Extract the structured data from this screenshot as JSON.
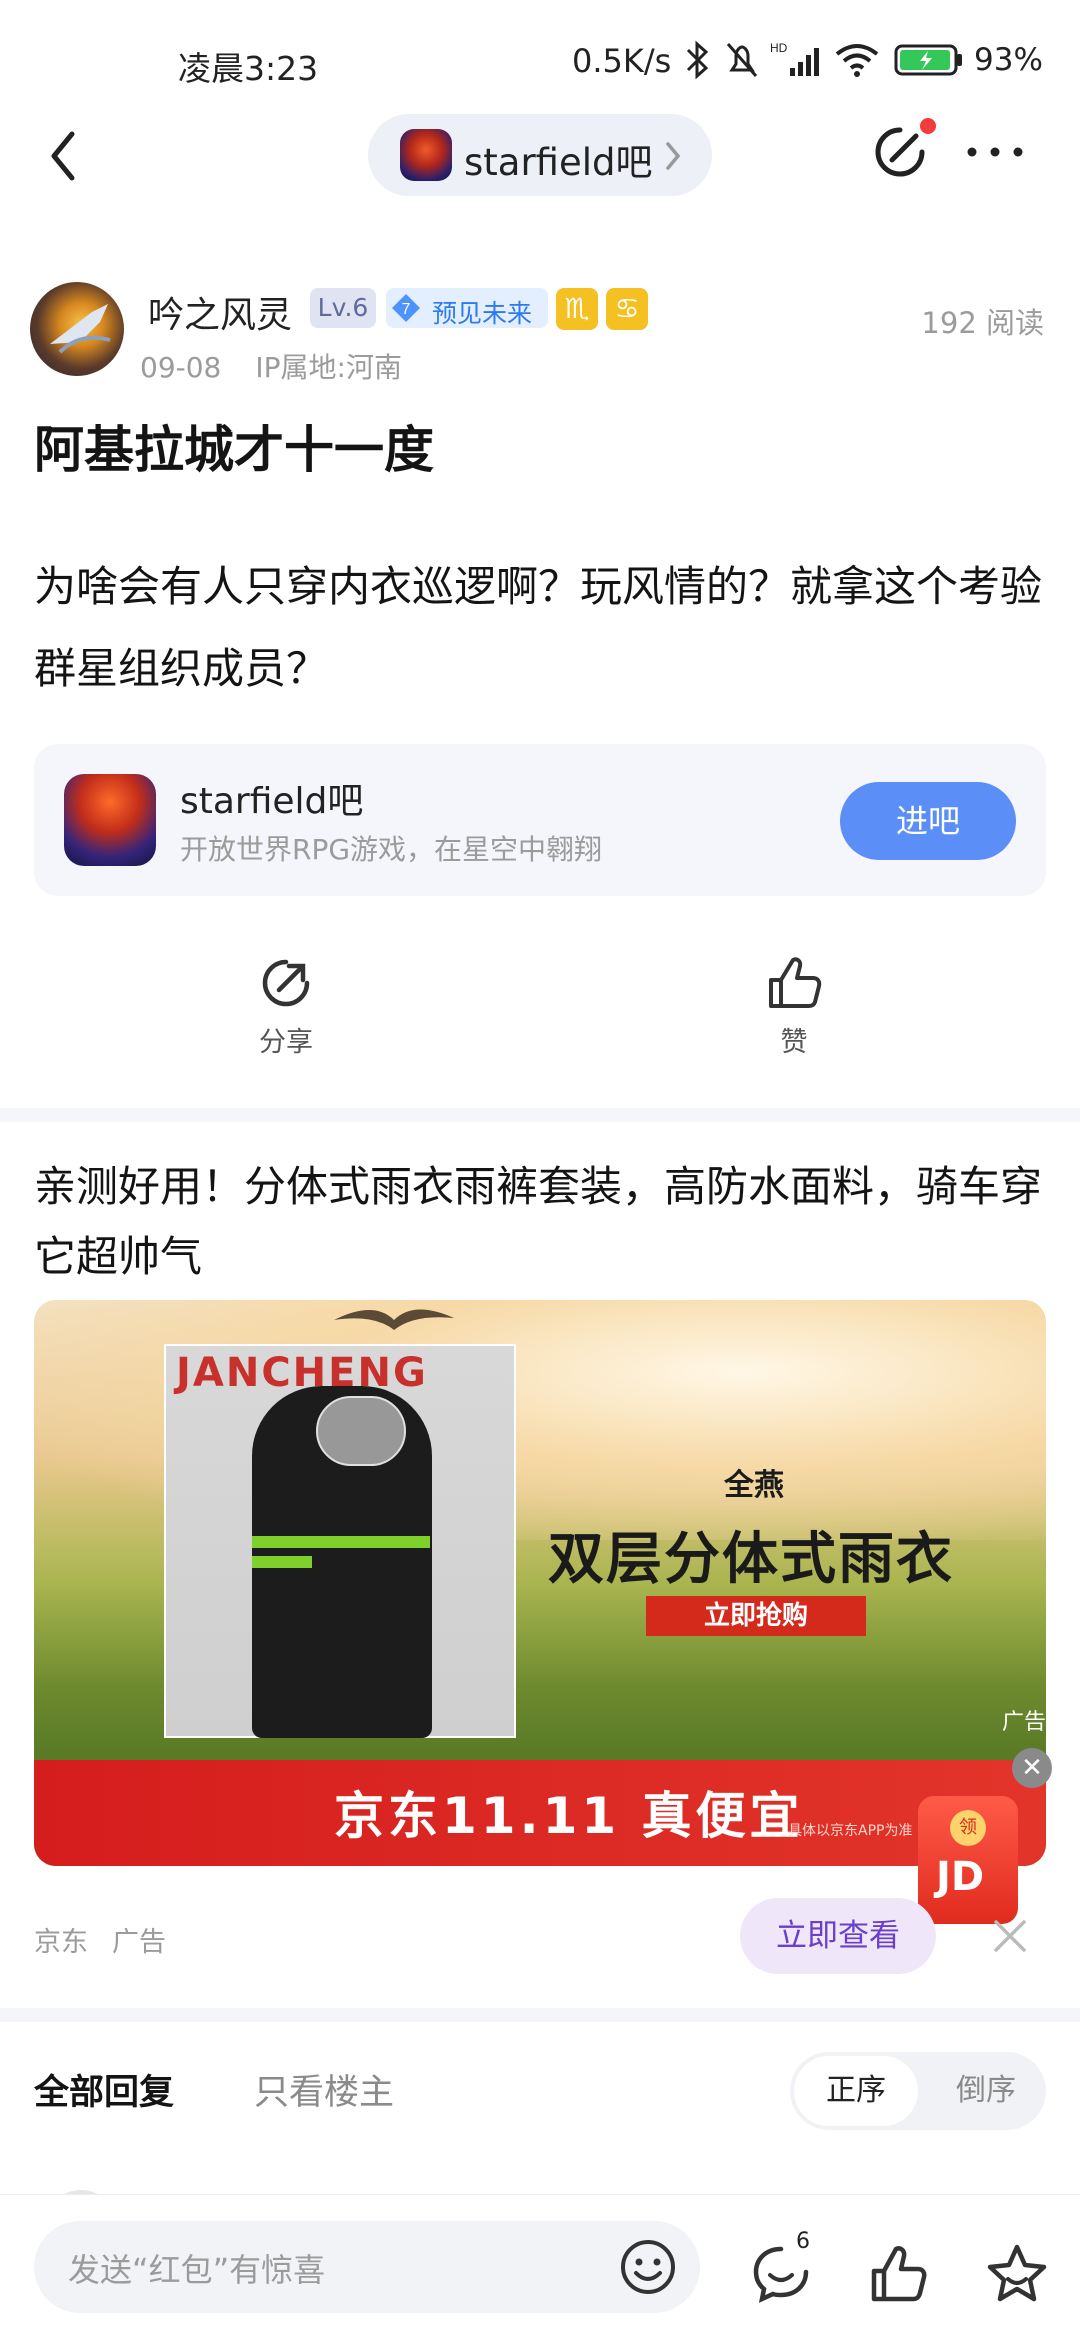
{
  "status_bar": {
    "time": "凌晨3:23",
    "network_speed": "0.5K/s",
    "battery": "93%"
  },
  "nav": {
    "forum_name": "starfield吧"
  },
  "post": {
    "author": "吟之风灵",
    "level": "Lv.6",
    "badge_number": "7",
    "badge_text": "预见未来",
    "zodiac_1": "♏",
    "zodiac_2": "♋",
    "date": "09-08",
    "ip_location": "IP属地:河南",
    "reads": "192 阅读",
    "title": "阿基拉城才十一度",
    "content": "为啥会有人只穿内衣巡逻啊？玩风情的？就拿这个考验群星组织成员？"
  },
  "forum_card": {
    "name": "starfield吧",
    "description": "开放世界RPG游戏，在星空中翱翔",
    "enter_label": "进吧"
  },
  "actions": {
    "share_label": "分享",
    "like_label": "赞"
  },
  "ad": {
    "title": "亲测好用！分体式雨衣雨裤套装，高防水面料，骑车穿它超帅气",
    "image_wall_text": "JANCHENG",
    "image_brand": "全燕",
    "image_headline": "双层分体式雨衣",
    "image_buy": "立即抢购",
    "image_slogan": "京东11.11 真便宜",
    "image_fineprint": "具体以京东APP为准",
    "image_ad_tag": "广告",
    "float_coin": "领",
    "float_jd": "JD",
    "source": "京东",
    "ad_label": "广告",
    "view_button": "立即查看"
  },
  "replies": {
    "tab_all": "全部回复",
    "tab_op": "只看楼主",
    "sort_asc": "正序",
    "sort_desc": "倒序"
  },
  "bottom_bar": {
    "input_placeholder": "发送“红包”有惊喜",
    "comment_count": "6"
  },
  "colors": {
    "accent_blue": "#5c8ef7",
    "view_purple": "#6a3fc9",
    "jd_red": "#e02b1f"
  }
}
